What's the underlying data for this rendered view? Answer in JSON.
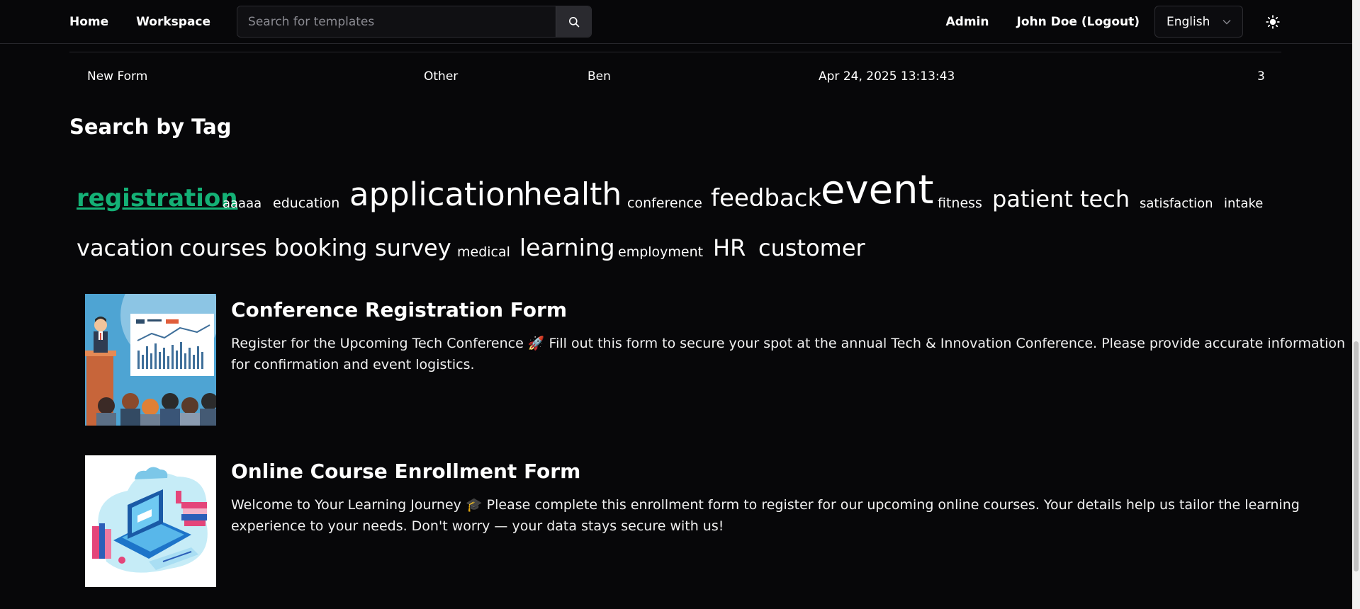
{
  "nav": {
    "home": "Home",
    "workspace": "Workspace",
    "search_placeholder": "Search for templates",
    "admin": "Admin",
    "user": "John Doe (Logout)",
    "language": "English"
  },
  "table": {
    "row": {
      "title": "New Form",
      "topic": "Other",
      "author": "Ben",
      "date": "Apr 24, 2025 13:13:43",
      "count": "3"
    }
  },
  "tags": {
    "heading": "Search by Tag",
    "items": [
      "registration",
      "aaaaa",
      "education",
      "application",
      "health",
      "conference",
      "feedback",
      "event",
      "fitness",
      "patient",
      "tech",
      "satisfaction",
      "intake",
      "vacation",
      "courses",
      "booking",
      "survey",
      "medical",
      "learning",
      "employment",
      "HR",
      "customer"
    ],
    "active": "registration",
    "accent_color": "#14b176"
  },
  "cards": [
    {
      "title": "Conference Registration Form",
      "description": "Register for the Upcoming Tech Conference 🚀 Fill out this form to secure your spot at the annual Tech & Innovation Conference. Please provide accurate information for confirmation and event logistics.",
      "thumbnail": "conference-presentation-illustration"
    },
    {
      "title": "Online Course Enrollment Form",
      "description": "Welcome to Your Learning Journey 🎓 Please complete this enrollment form to register for our upcoming online courses. Your details help us tailor the learning experience to your needs. Don't worry — your data stays secure with us!",
      "thumbnail": "online-learning-laptop-illustration"
    }
  ],
  "icons": {
    "search": "search-icon",
    "dropdown": "chevron-down-icon",
    "theme": "sun-icon"
  }
}
